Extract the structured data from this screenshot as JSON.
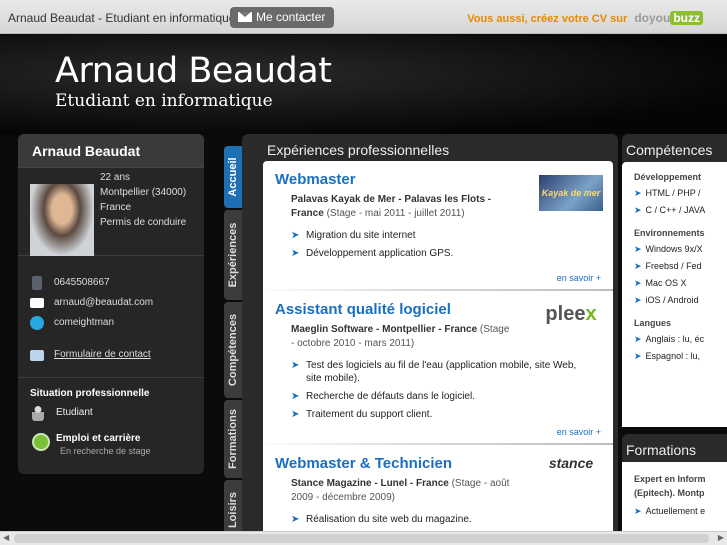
{
  "topbar": {
    "site_title": "Arnaud Beaudat - Etudiant en informatique",
    "contact_label": "Me contacter",
    "promo_text": "Vous aussi, créez votre CV sur",
    "brand_part1": "doyou",
    "brand_part2": "buzz"
  },
  "hero": {
    "name": "Arnaud Beaudat",
    "subtitle": "Etudiant en informatique"
  },
  "sidebar": {
    "name": "Arnaud Beaudat",
    "facts": [
      "22 ans",
      "Montpellier (34000)",
      "France",
      "Permis de conduire"
    ],
    "phone": "0645508667",
    "email": "arnaud@beaudat.com",
    "skype": "comeightman",
    "contact_form": "Formulaire de contact",
    "situation_title": "Situation professionnelle",
    "status": "Etudiant",
    "job_title": "Emploi et carrière",
    "job_status": "En recherche de stage"
  },
  "tabs": [
    "Accueil",
    "Expériences",
    "Compétences",
    "Formations",
    "Loisirs"
  ],
  "experiences": {
    "title": "Expériences professionnelles",
    "more_label": "en savoir +",
    "jobs": [
      {
        "title": "Webmaster",
        "org": "Palavas Kayak de Mer - Palavas les Flots - France",
        "detail": "(Stage - mai 2011 - juillet 2011)",
        "logo": "Kayak de mer",
        "items": [
          "Migration du site internet",
          "Développement application GPS."
        ]
      },
      {
        "title": "Assistant qualité logiciel",
        "org": "Maeglin Software - Montpellier - France",
        "detail": "(Stage - octobre 2010 - mars 2011)",
        "logo": "pleex",
        "items": [
          "Test des logiciels au fil de l'eau (application mobile, site Web, site mobile).",
          "Recherche de défauts dans le logiciel.",
          "Traitement du support client."
        ]
      },
      {
        "title": "Webmaster & Technicien",
        "org": "Stance Magazine - Lunel - France",
        "detail": "(Stage - août 2009 - décembre 2009)",
        "logo": "stance",
        "items": [
          "Réalisation du site web du magazine."
        ]
      }
    ]
  },
  "competences": {
    "title": "Compétences",
    "sections": [
      {
        "name": "Développement",
        "items": [
          "HTML / PHP /",
          "C / C++ / JAVA"
        ]
      },
      {
        "name": "Environnements",
        "items": [
          "Windows 9x/X",
          "Freebsd / Fed",
          "Mac OS X",
          "iOS / Android"
        ]
      },
      {
        "name": "Langues",
        "items": [
          "Anglais : lu, éc",
          "Espagnol : lu,"
        ]
      }
    ]
  },
  "formations": {
    "title": "Formations",
    "entry": "Expert en Inform (Epitech). Montp",
    "item": "Actuellement e"
  }
}
